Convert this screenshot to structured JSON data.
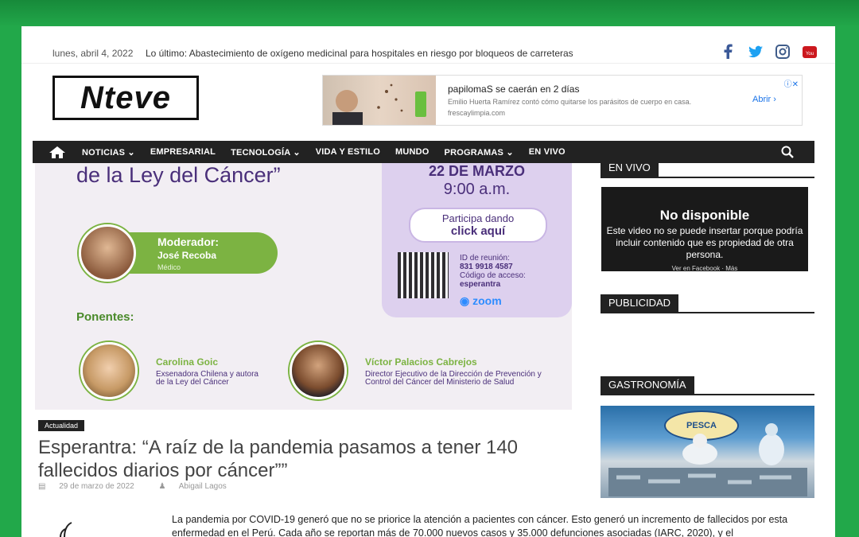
{
  "topbar": {
    "date": "lunes, abril 4, 2022",
    "latest_label": "Lo último:",
    "latest_text": "Abastecimiento de oxígeno medicinal para hospitales en riesgo por bloqueos de carreteras",
    "social_icons": [
      "facebook-icon",
      "twitter-icon",
      "instagram-icon",
      "youtube-icon"
    ]
  },
  "brand": {
    "logo": "Nteve"
  },
  "ad": {
    "title": "papilomaS se caerán en 2 días",
    "subtitle": "Emilio Huerta Ramírez contó cómo quitarse los parásitos de cuerpo en casa.",
    "site": "frescaylimpia.com",
    "button": "Abrir"
  },
  "nav": {
    "items": [
      "NOTICIAS",
      "EMPRESARIAL",
      "TECNOLOGÍA",
      "VIDA Y ESTILO",
      "MUNDO",
      "PROGRAMAS",
      "EN VIVO"
    ],
    "dropdown_marker": "⌄"
  },
  "hero": {
    "title": "de la Ley del Cáncer”",
    "date": "22 DE MARZO",
    "time": "9:00 a.m.",
    "btn_line1": "Participa dando",
    "btn_line2": "click aquí",
    "meeting_id_label": "ID de reunión:",
    "meeting_id": "831 9918 4587",
    "access_label": "Código de acceso:",
    "access_code": "esperantra",
    "zoom": "zoom",
    "moderator_label": "Moderador:",
    "moderator_name": "José Recoba",
    "moderator_role": "Médico",
    "speakers_label": "Ponentes:",
    "speaker1_name": "Carolina Goic",
    "speaker1_role": "Exsenadora Chilena y autora de la Ley del Cáncer",
    "speaker2_name": "Víctor Palacios Cabrejos",
    "speaker2_role": "Director Ejecutivo de la Dirección de Prevención y Control del Cáncer del Ministerio de Salud"
  },
  "article": {
    "category": "Actualidad",
    "title": "Esperantra: “A raíz de la pandemia pasamos a tener 140 fallecidos diarios por cáncer””",
    "date": "29 de marzo de 2022",
    "author": "Abigail Lagos",
    "body": "La pandemia por COVID-19 generó que no se priorice la atención a pacientes con cáncer. Esto generó un incremento de fallecidos por esta enfermedad en el Perú. Cada año se reportan más de 70.000 nuevos casos y 35.000 defunciones asociadas (IARC, 2020), y el"
  },
  "sidebar": {
    "live_title": "EN VIVO",
    "video_title": "No disponible",
    "video_text": "Este video no se puede insertar porque podría incluir contenido que es propiedad de otra persona.",
    "video_more": "Ver en Facebook · Más",
    "ads_title": "PUBLICIDAD",
    "gastro_title": "GASTRONOMÍA",
    "gastro_sign": "PESCA"
  },
  "colors": {
    "frame": "#22a84a",
    "nav": "#222222",
    "accent_purple": "#4a2f7a",
    "accent_green": "#7cb342"
  }
}
